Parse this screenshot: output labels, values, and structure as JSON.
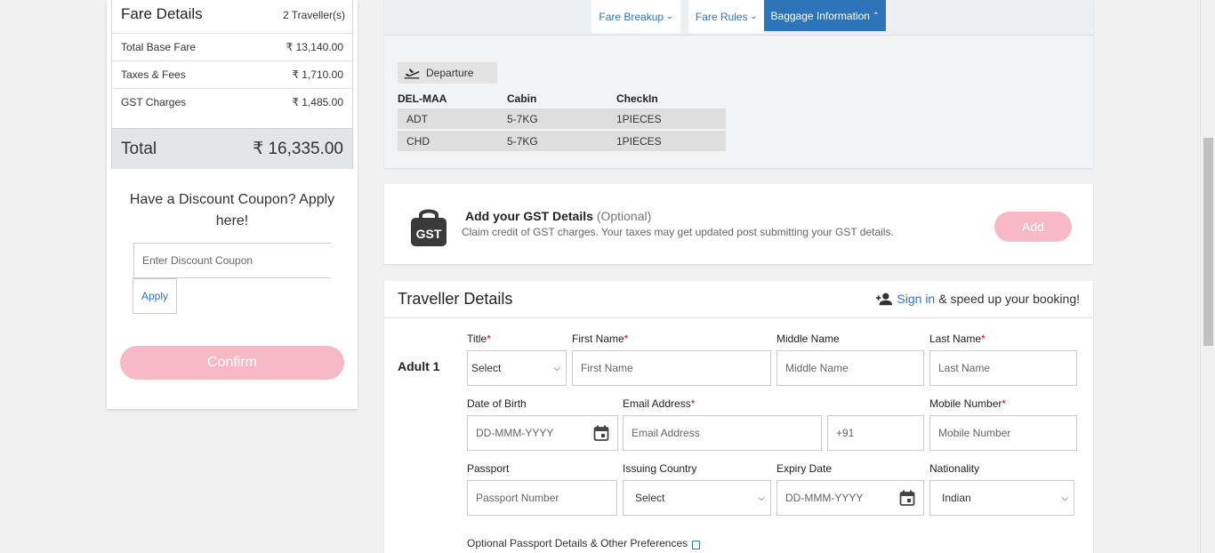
{
  "fare": {
    "title": "Fare Details",
    "travellers": "2 Traveller(s)",
    "rows": [
      {
        "label": "Total Base Fare",
        "value": "₹ 13,140.00"
      },
      {
        "label": "Taxes & Fees",
        "value": "₹ 1,710.00"
      },
      {
        "label": "GST Charges",
        "value": "₹ 1,485.00"
      }
    ],
    "total_label": "Total",
    "total_value": "₹ 16,335.00"
  },
  "coupon": {
    "title": "Have a Discount Coupon? Apply here!",
    "placeholder": "Enter Discount Coupon",
    "apply_label": "Apply",
    "confirm_label": "Confirm"
  },
  "tabs": [
    {
      "label": "Fare Breakup",
      "active": false
    },
    {
      "label": "Fare Rules",
      "active": false
    },
    {
      "label": "Baggage Information",
      "active": true
    }
  ],
  "baggage": {
    "direction": "Departure",
    "headers": [
      "DEL-MAA",
      "Cabin",
      "CheckIn"
    ],
    "rows": [
      [
        "ADT",
        "5-7KG",
        "1PIECES"
      ],
      [
        "CHD",
        "5-7KG",
        "1PIECES"
      ]
    ]
  },
  "gst": {
    "icon_text": "GST",
    "title": "Add your GST Details",
    "optional": "(Optional)",
    "subtitle": "Claim credit of GST charges. Your taxes may get updated post submitting your GST details.",
    "add_label": "Add"
  },
  "traveller": {
    "title": "Traveller Details",
    "signin_link": "Sign in",
    "signin_rest": "& speed up your booking!",
    "adult_label": "Adult 1",
    "labels": {
      "title": "Title",
      "first_name": "First Name",
      "middle_name": "Middle Name",
      "last_name": "Last Name",
      "dob": "Date of Birth",
      "email": "Email Address",
      "mobile": "Mobile Number",
      "passport": "Passport",
      "issuing_country": "Issuing Country",
      "expiry": "Expiry Date",
      "nationality": "Nationality"
    },
    "required_mark": "*",
    "values": {
      "title_select": "Select",
      "first_name_ph": "First Name",
      "middle_name_ph": "Middle Name",
      "last_name_ph": "Last Name",
      "dob_ph": "DD-MMM-YYYY",
      "email_ph": "Email Address",
      "country_code": "+91",
      "mobile_ph": "Mobile Number",
      "passport_ph": "Passport Number",
      "issuing_select": "Select",
      "expiry_ph": "DD-MMM-YYYY",
      "nationality_select": "Indian"
    },
    "optional_passport": "Optional Passport Details & Other Preferences"
  },
  "icons": {
    "plane": "plane-departure-icon",
    "user_add": "user-add-icon",
    "calendar": "calendar-icon",
    "lock": "gst-lock-icon",
    "chevron": "chevron-down-icon"
  },
  "colors": {
    "accent": "#2e74b9",
    "pink_button": "#f8b9c6",
    "required": "#d0021b"
  }
}
